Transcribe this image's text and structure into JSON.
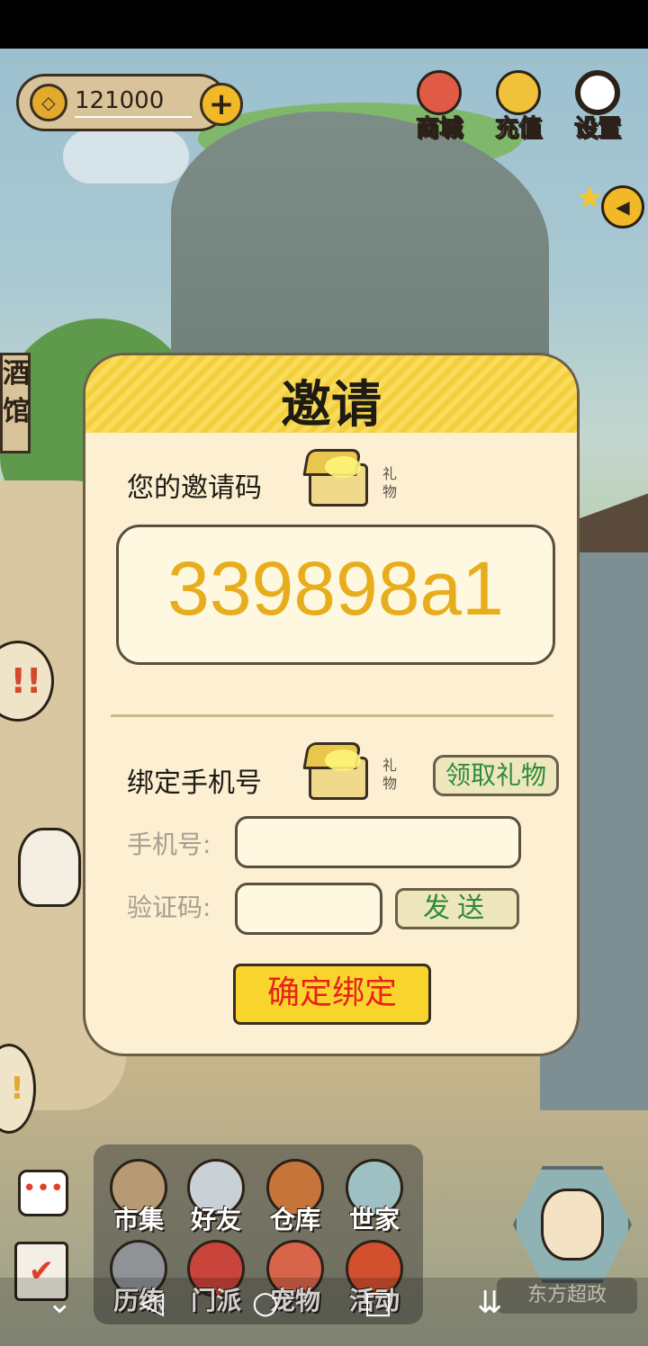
{
  "top_bar": {
    "coins": "121000",
    "coin_symbol": "◇",
    "plus_symbol": "+"
  },
  "top_menu": [
    {
      "label": "商城",
      "icon": "shop-bag-icon",
      "color": "#e05a45"
    },
    {
      "label": "充值",
      "icon": "gold-ingot-icon",
      "color": "#f0c23a"
    },
    {
      "label": "设置",
      "icon": "gear-icon",
      "color": "#ffffff"
    }
  ],
  "side": {
    "tavern_label": "酒馆"
  },
  "dialog": {
    "title": "邀请",
    "invite_code_label": "您的邀请码",
    "gift_tag": "礼物",
    "invite_code": "339898a1",
    "bind_phone_label": "绑定手机号",
    "claim_gift_button": "领取礼物",
    "phone_label": "手机号:",
    "phone_value": "",
    "verify_label": "验证码:",
    "verify_value": "",
    "send_button": "发送",
    "confirm_button": "确定绑定"
  },
  "bottom_nav": [
    {
      "label": "市集",
      "icon": "market-icon"
    },
    {
      "label": "好友",
      "icon": "handshake-icon"
    },
    {
      "label": "仓库",
      "icon": "chest-icon"
    },
    {
      "label": "世家",
      "icon": "clan-icon"
    },
    {
      "label": "历练",
      "icon": "swords-icon"
    },
    {
      "label": "门派",
      "icon": "banner-icon"
    },
    {
      "label": "宠物",
      "icon": "paw-icon"
    },
    {
      "label": "活动",
      "icon": "lantern-icon"
    }
  ],
  "player": {
    "name": "东方超政"
  },
  "colors": {
    "accent_yellow": "#f8d52d",
    "code_text": "#e7ad1c",
    "confirm_text": "#e8231a",
    "green_text": "#2f8a3b"
  }
}
